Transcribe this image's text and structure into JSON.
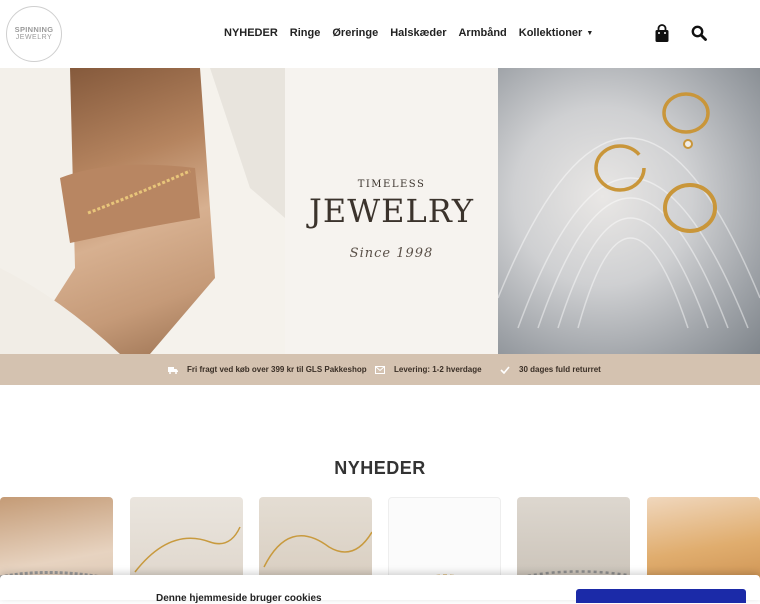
{
  "logo": {
    "line1": "SPINNING",
    "line2": "JEWELRY"
  },
  "nav": {
    "items": [
      {
        "label": "NYHEDER"
      },
      {
        "label": "Ringe"
      },
      {
        "label": "Øreringe"
      },
      {
        "label": "Halskæder"
      },
      {
        "label": "Armbånd"
      },
      {
        "label": "Kollektioner"
      }
    ]
  },
  "icons": {
    "cart": "shopping-bag-icon",
    "search": "search-icon",
    "dropdown": "caret-down-icon"
  },
  "hero": {
    "timeless": "TIMELESS",
    "jewelry": "JEWELRY",
    "since": "Since 1998"
  },
  "usp": {
    "shipping": "Fri fragt ved køb over 399 kr til GLS Pakkeshop",
    "delivery": "Levering: 1-2 hverdage",
    "returns": "30 dages fuld returret"
  },
  "section": {
    "title": "NYHEDER"
  },
  "cookie": {
    "text": "Denne hjemmeside bruger cookies"
  },
  "colors": {
    "usp_bar": "#d4c2b0",
    "cookie_button": "#1b2aa8"
  }
}
